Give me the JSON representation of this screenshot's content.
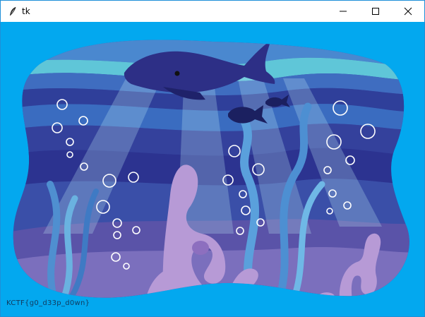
{
  "window": {
    "title": "tk",
    "icon": "feather-icon",
    "controls": [
      "minimize-icon",
      "maximize-icon",
      "close-icon"
    ]
  },
  "canvas": {
    "background": "#03a8ef",
    "flag_text": "KCTF{g0_d33p_d0wn}"
  }
}
